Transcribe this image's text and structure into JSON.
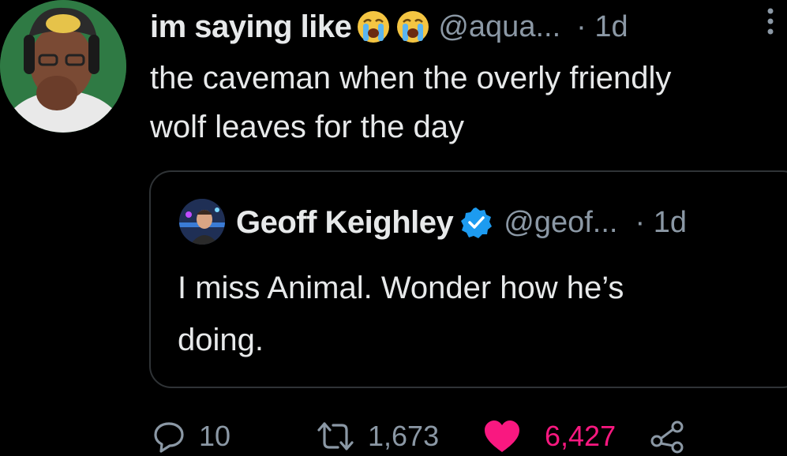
{
  "tweet": {
    "display_name": "im saying like",
    "handle": "@aqua...",
    "timestamp": "· 1d",
    "text_lines": [
      "the caveman when the overly friendly",
      "wolf leaves for the day"
    ],
    "emojis": [
      "loudly-crying-face-icon",
      "loudly-crying-face-icon"
    ]
  },
  "quote": {
    "display_name": "Geoff Keighley",
    "verified": true,
    "handle": "@geof...",
    "timestamp": "· 1d",
    "text_lines": [
      "I miss Animal. Wonder how he’s",
      "doing."
    ]
  },
  "actions": {
    "reply_count": "10",
    "retweet_count": "1,673",
    "like_count": "6,427",
    "liked": true
  },
  "colors": {
    "background": "#000000",
    "text": "#e7e9ea",
    "secondary": "#8b98a5",
    "like": "#f91880",
    "verified": "#1d9bf0",
    "border": "#2f3336"
  }
}
